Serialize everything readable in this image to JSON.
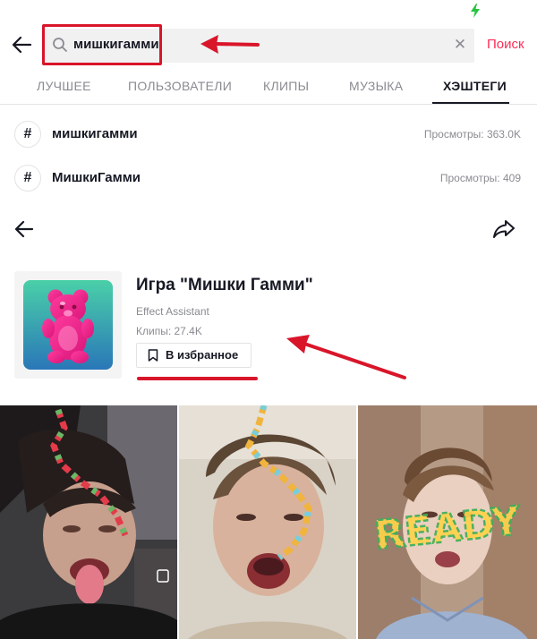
{
  "search": {
    "query": "мишкигамми",
    "submit_label": "Поиск"
  },
  "tabs": [
    {
      "label": "ЛУЧШЕЕ"
    },
    {
      "label": "ПОЛЬЗОВАТЕЛИ"
    },
    {
      "label": "КЛИПЫ"
    },
    {
      "label": "МУЗЫКА"
    },
    {
      "label": "ХЭШТЕГИ",
      "active": true
    }
  ],
  "hashtags": [
    {
      "name": "мишкигамми",
      "views": "Просмотры: 363.0K"
    },
    {
      "name": "МишкиГамми",
      "views": "Просмотры: 409"
    }
  ],
  "effect": {
    "title": "Игра \"Мишки Гамми\"",
    "author": "Effect Assistant",
    "clips": "Клипы: 27.4K",
    "favorite_label": "В избранное"
  },
  "videos": [
    {
      "overlay_text": ""
    },
    {
      "overlay_text": ""
    },
    {
      "overlay_text": "READY"
    }
  ],
  "colors": {
    "accent": "#fe2c55",
    "annotation_red": "#d9152a",
    "battery": "#25c43c",
    "muted_text": "#8a8b91"
  },
  "icons": [
    "battery-charging-icon",
    "back-arrow-icon",
    "search-icon",
    "clear-icon",
    "hash-icon",
    "share-icon",
    "bookmark-icon",
    "gummy-bear-icon"
  ]
}
